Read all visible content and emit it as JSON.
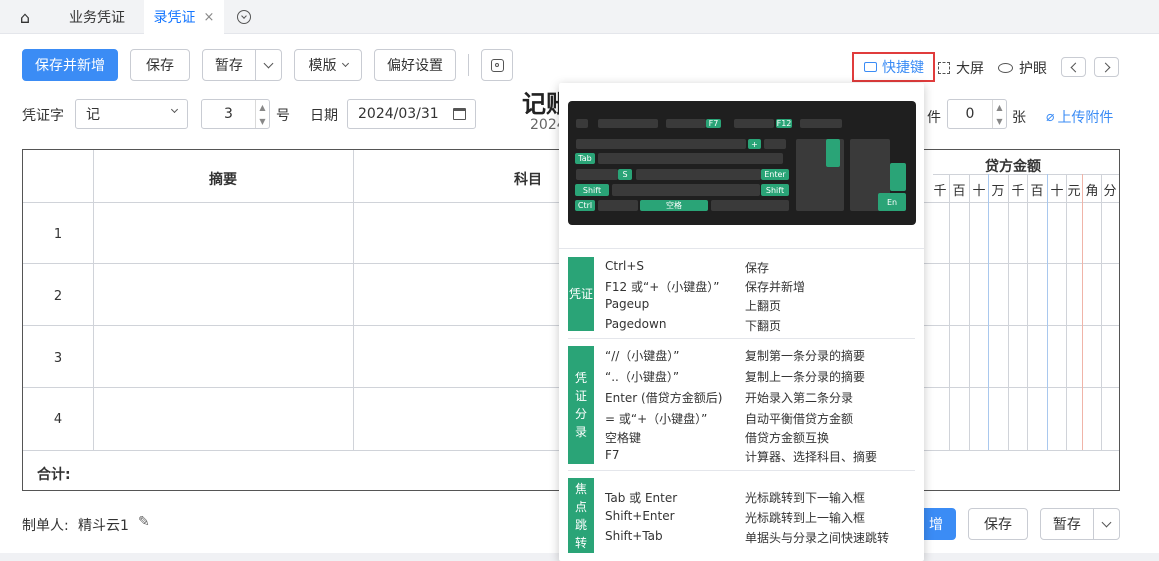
{
  "tabs": {
    "home": "⌂",
    "t1": "业务凭证",
    "t2": "录凭证",
    "close": "×",
    "more": "⌄"
  },
  "toolbar": {
    "save_new": "保存并新增",
    "save": "保存",
    "temp": "暂存",
    "template": "模版",
    "pref": "偏好设置",
    "shortcut": "快捷键",
    "fullscreen": "大屏",
    "eye": "护眼"
  },
  "form": {
    "word_label": "凭证字",
    "word_value": "记",
    "num_value": "3",
    "num_suffix": "号",
    "date_label": "日期",
    "date_value": "2024/03/31",
    "title": "记账",
    "sub": "2024",
    "att_label": "件",
    "att_value": "0",
    "att_suffix": "张",
    "upload": "上传附件"
  },
  "grid": {
    "summary": "摘要",
    "subject": "科目",
    "credit": "贷方金额",
    "rows": [
      "1",
      "2",
      "3",
      "4"
    ],
    "total": "合计:",
    "units": [
      "千",
      "百",
      "十",
      "万",
      "千",
      "百",
      "十",
      "元",
      "角",
      "分"
    ]
  },
  "footer": {
    "maker_label": "制单人:",
    "maker": "精斗云1",
    "save_new_part": "增",
    "save": "保存",
    "temp": "暂存"
  },
  "popup": {
    "s1": {
      "title": "凭证",
      "rows": [
        [
          "Ctrl+S",
          "保存"
        ],
        [
          "F12 或“+（小键盘）”",
          "保存并新增"
        ],
        [
          "Pageup",
          "上翻页"
        ],
        [
          "Pagedown",
          "下翻页"
        ]
      ]
    },
    "s2": {
      "title": "凭证分录",
      "rows": [
        [
          "“//（小键盘）”",
          "复制第一条分录的摘要"
        ],
        [
          "“..（小键盘）”",
          "复制上一条分录的摘要"
        ],
        [
          "Enter (借贷方金额后)",
          "开始录入第二条分录"
        ],
        [
          "= 或“+（小键盘）”",
          "自动平衡借贷方金额"
        ],
        [
          "空格键",
          "借贷方金额互换"
        ],
        [
          "F7",
          "计算器、选择科目、摘要"
        ]
      ]
    },
    "s3": {
      "title": "焦点跳转",
      "rows": [
        [
          "Tab 或 Enter",
          "光标跳转到下一输入框"
        ],
        [
          "Shift+Enter",
          "光标跳转到上一输入框"
        ],
        [
          "Shift+Tab",
          "单据头与分录之间快速跳转"
        ]
      ]
    },
    "keys": {
      "tab": "Tab",
      "shift": "Shift",
      "ctrl": "Ctrl",
      "space": "空格",
      "enter": "Enter",
      "f7": "F7",
      "f12": "F12",
      "s": "S",
      "plus": "+",
      "en": "En"
    }
  },
  "colors": {
    "accent": "#3b8cf5",
    "green": "#2aa477",
    "highlight": "#e03c3c"
  }
}
